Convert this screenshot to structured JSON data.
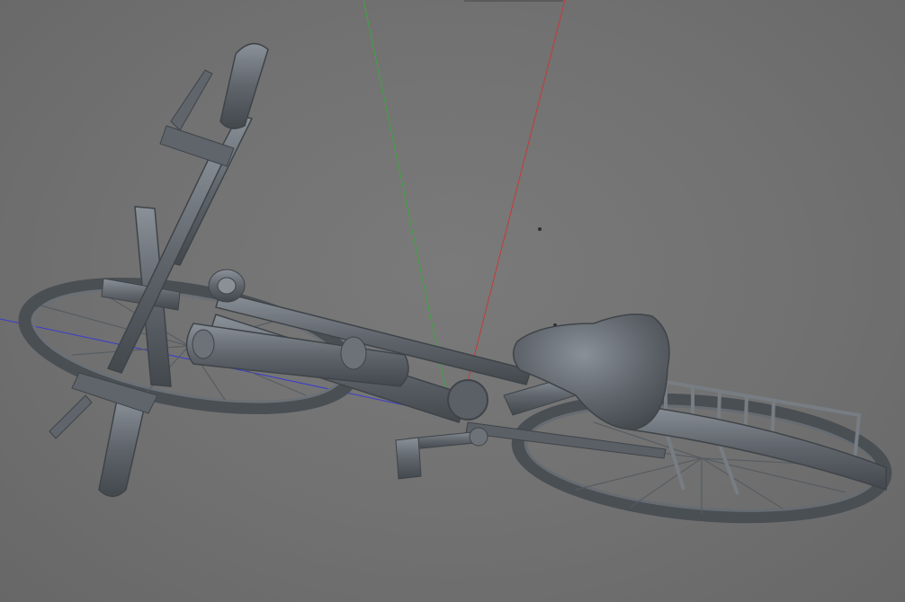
{
  "viewport": {
    "background_color": "#707070",
    "model_color": "#5b6066",
    "model_edge_color": "#3f4449",
    "model_highlight_color": "#8a9096",
    "axes": {
      "x_axis_color": "#c43a3a",
      "y_axis_color": "#3fa33f",
      "z_axis_color": "#3a3ad0"
    }
  },
  "scene": {
    "object": "bicycle-3d-model",
    "parts": [
      "handlebar",
      "left-grip",
      "right-grip",
      "brake-lever-left",
      "brake-lever-right",
      "stem",
      "front-fork",
      "front-wheel",
      "down-tube",
      "top-tube",
      "seat-tube",
      "saddle",
      "rear-rack",
      "rear-wheel",
      "rear-fender",
      "pedal",
      "crank",
      "chainring",
      "headlight",
      "battery-pack"
    ]
  }
}
